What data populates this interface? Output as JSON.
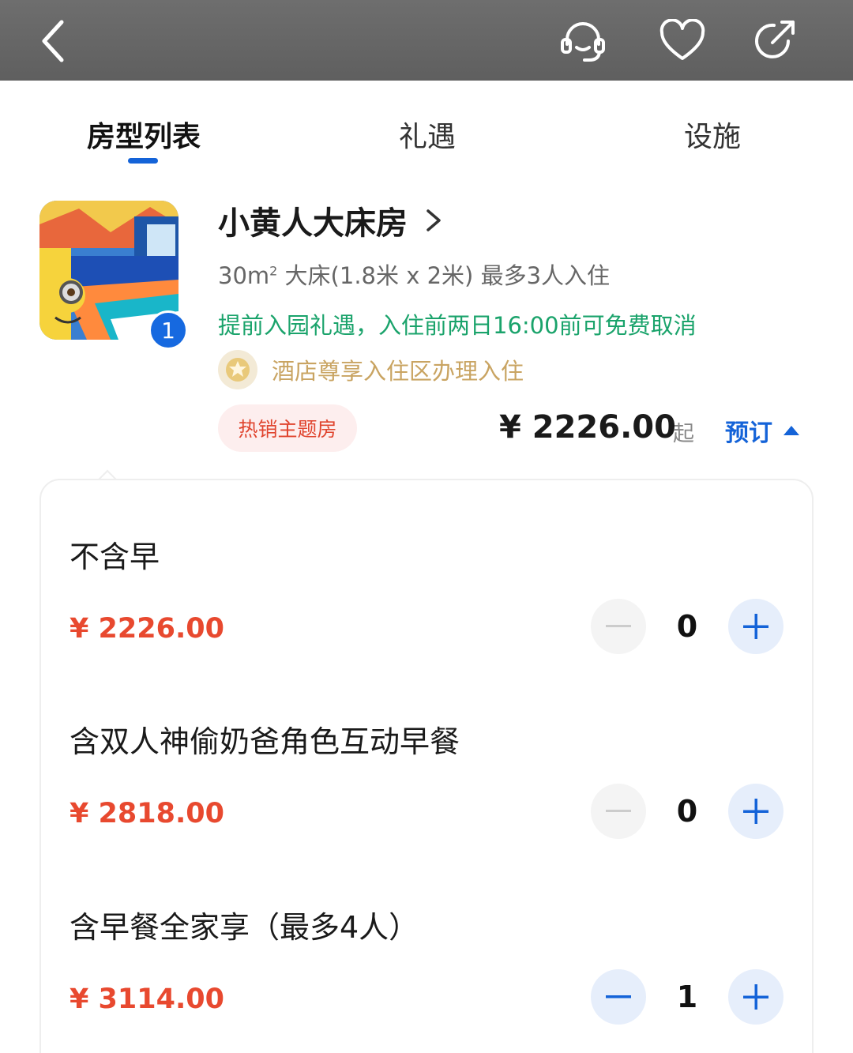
{
  "tabs": [
    {
      "label": "房型列表"
    },
    {
      "label": "礼遇"
    },
    {
      "label": "设施"
    }
  ],
  "room": {
    "name": "小黄人大床房",
    "thumb_badge": "1",
    "area": "30m",
    "area_sup": "2",
    "spec": " 大床(1.8米 x 2米) 最多3人入住",
    "perk": "提前入园礼遇，入住前两日16:00前可免费取消",
    "gold_text": "酒店尊享入住区办理入住",
    "hot_tag": "热销主题房",
    "price": "¥ 2226.00",
    "price_suffix": "起",
    "book_label": "预订"
  },
  "rates": [
    {
      "name": "不含早",
      "price": "¥ 2226.00",
      "qty": "0"
    },
    {
      "name": "含双人神偷奶爸角色互动早餐",
      "price": "¥ 2818.00",
      "qty": "0"
    },
    {
      "name": "含早餐全家享（最多4人）",
      "price": "¥ 3114.00",
      "qty": "1"
    }
  ],
  "colors": {
    "accent_blue": "#1463d8",
    "price_red": "#e8492f",
    "perk_green": "#1aa36b",
    "gold": "#c9a462"
  }
}
